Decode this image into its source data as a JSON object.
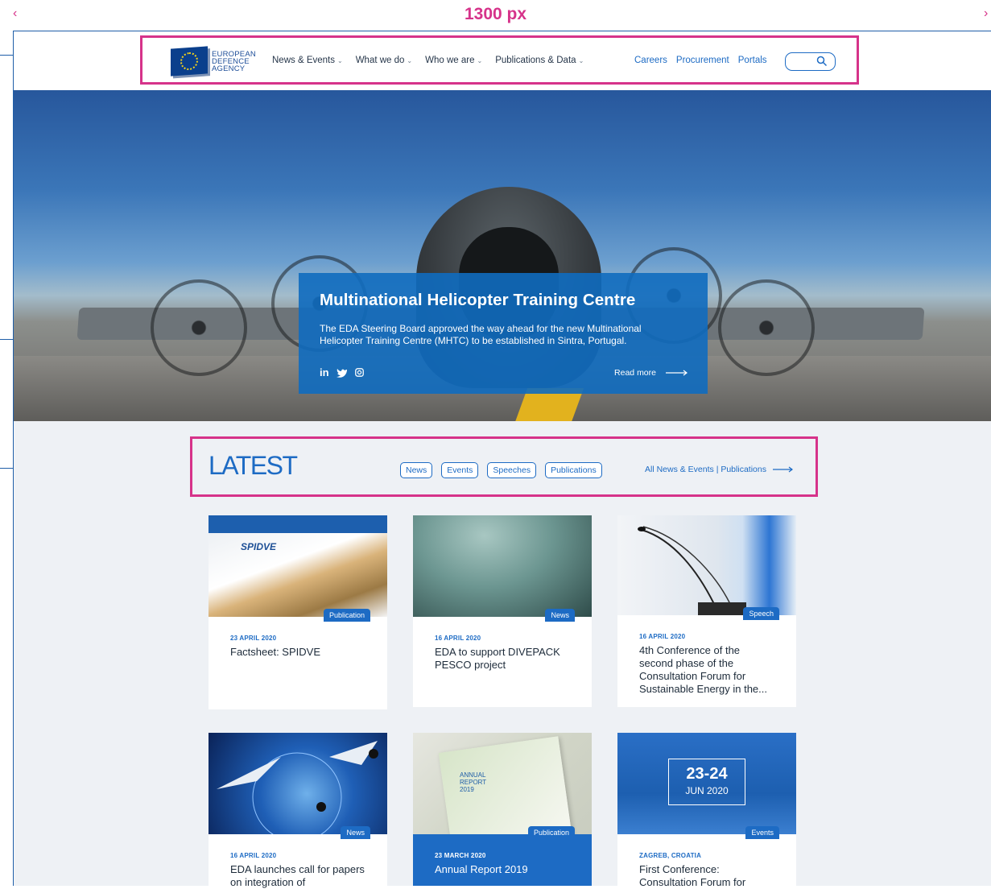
{
  "spec": {
    "width_label": "1300 px",
    "left_arrow": "‹",
    "right_arrow": "›"
  },
  "header": {
    "logo_lines": [
      "EUROPEAN",
      "DEFENCE",
      "AGENCY"
    ],
    "nav": [
      "News & Events",
      "What we do",
      "Who we are",
      "Publications & Data"
    ],
    "links": [
      "Careers",
      "Procurement",
      "Portals"
    ]
  },
  "hero": {
    "title": "Multinational Helicopter Training Centre",
    "text": "The EDA Steering Board approved the way ahead for the new Multinational Helicopter Training Centre (MHTC) to be established in Sintra, Portugal.",
    "social": [
      "in",
      "twitter-icon",
      "instagram-icon"
    ],
    "read_more": "Read more"
  },
  "latest": {
    "title": "LATEST",
    "filters": [
      "News",
      "Events",
      "Speeches",
      "Publications"
    ],
    "all_link": "All News & Events | Publications",
    "cards": [
      {
        "badge": "Publication",
        "date": "23 APRIL 2020",
        "title": "Factsheet: SPIDVE",
        "img_text": "SPIDVE"
      },
      {
        "badge": "News",
        "date": "16 APRIL 2020",
        "title": "EDA to support DIVEPACK PESCO project"
      },
      {
        "badge": "Speech",
        "date": "16 APRIL 2020",
        "title": "4th Conference of the second phase of the Consultation Forum for Sustainable Energy in the..."
      },
      {
        "badge": "News",
        "date": "16 APRIL 2020",
        "title": "EDA launches call for papers on integration of"
      },
      {
        "badge": "Publication",
        "date": "23 MARCH 2020",
        "title": "Annual Report 2019",
        "img_text": "ANNUAL REPORT 2019"
      },
      {
        "badge": "Events",
        "date": "ZAGREB, CROATIA",
        "title": "First Conference: Consultation Forum for",
        "img_big": "23-24",
        "img_small": "JUN 2020"
      }
    ]
  }
}
